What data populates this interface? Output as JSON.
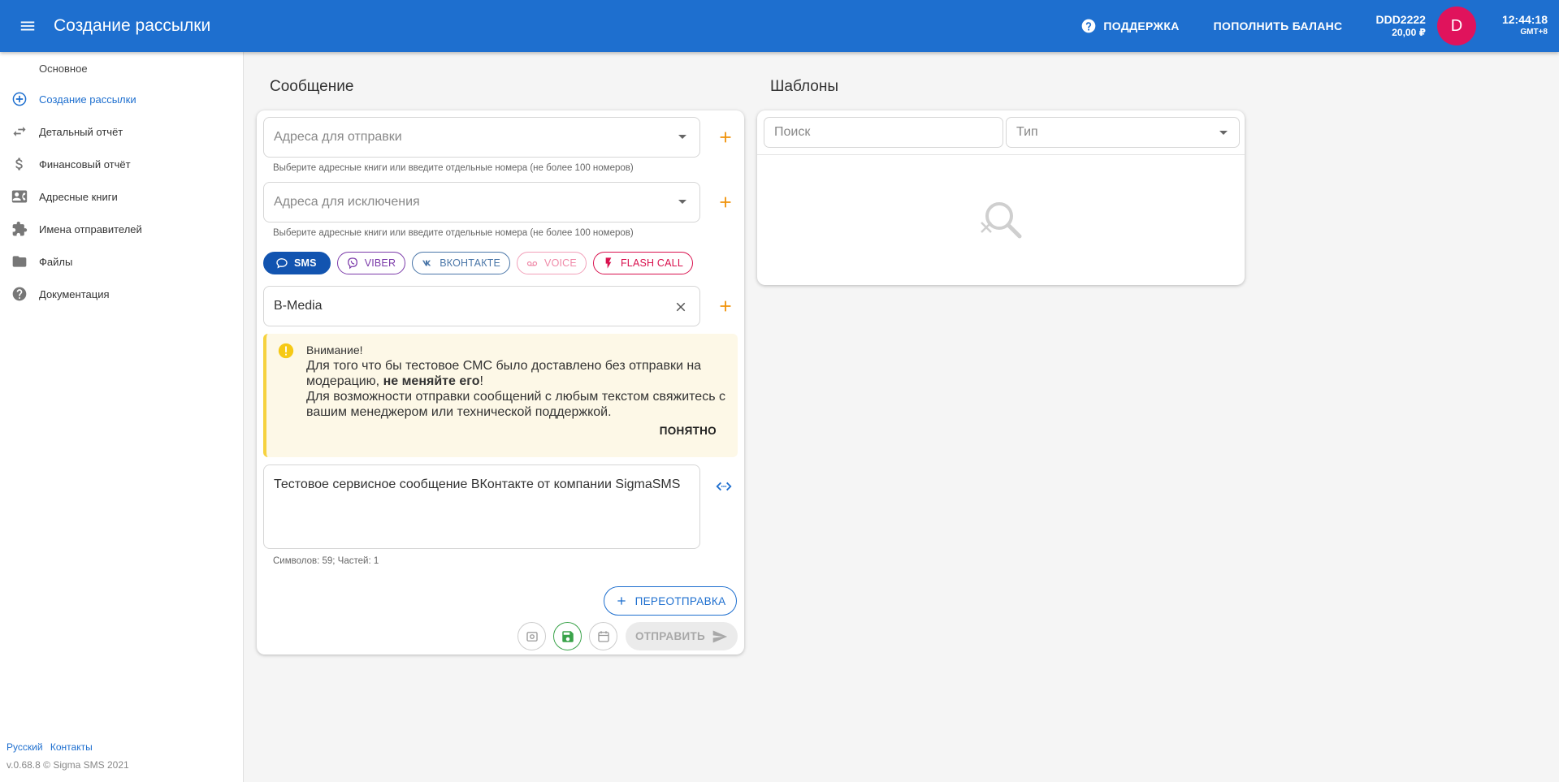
{
  "header": {
    "title": "Создание рассылки",
    "support_label": "ПОДДЕРЖКА",
    "topup_label": "ПОПОЛНИТЬ БАЛАНС",
    "account_name": "DDD2222",
    "balance": "20,00 ₽",
    "avatar_letter": "D",
    "time": "12:44:18",
    "timezone": "GMT+8",
    "colors": {
      "bar": "#1e6fcf",
      "avatar": "#e0135c"
    }
  },
  "sidebar": {
    "section": "Основное",
    "items": [
      {
        "label": "Создание рассылки",
        "icon": "plus-circle-icon",
        "active": true
      },
      {
        "label": "Детальный отчёт",
        "icon": "swap-arrows-icon"
      },
      {
        "label": "Финансовый отчёт",
        "icon": "dollar-icon"
      },
      {
        "label": "Адресные книги",
        "icon": "contact-card-icon"
      },
      {
        "label": "Имена отправителей",
        "icon": "puzzle-icon"
      },
      {
        "label": "Файлы",
        "icon": "folder-icon"
      },
      {
        "label": "Документация",
        "icon": "help-icon"
      }
    ],
    "footer": {
      "language": "Русский",
      "contacts": "Контакты",
      "version": "v.0.68.8 © Sigma SMS 2021"
    }
  },
  "message": {
    "heading": "Сообщение",
    "recipients": {
      "placeholder": "Адреса для отправки",
      "hint": "Выберите адресные книги или введите отдельные номера (не более 100 номеров)"
    },
    "exclusions": {
      "placeholder": "Адреса для исключения",
      "hint": "Выберите адресные книги или введите отдельные номера (не более 100 номеров)"
    },
    "channels": [
      {
        "label": "SMS",
        "icon": "chat-bubble-icon",
        "selected": true
      },
      {
        "label": "VIBER",
        "icon": "viber-icon"
      },
      {
        "label": "ВКОНТАКТЕ",
        "icon": "vk-icon"
      },
      {
        "label": "VOICE",
        "icon": "voicemail-icon"
      },
      {
        "label": "FLASH CALL",
        "icon": "flash-icon"
      }
    ],
    "sender": "B-Media",
    "alert": {
      "title": "Внимание!",
      "line1_before": "Для того что бы тестовое СМС было доставлено без отправки на модерацию, ",
      "line1_bold": "не меняйте его",
      "line1_after": "!",
      "line2": "Для возможности отправки сообщений с любым текстом свяжитесь с вашим менеджером или технической поддержкой.",
      "button": "ПОНЯТНО"
    },
    "text": "Тестовое сервисное сообщение ВКонтакте от компании SigmaSMS",
    "counter": "Символов: 59; Частей: 1",
    "resend_label": "ПЕРЕОТПРАВКА",
    "send_label": "ОТПРАВИТЬ"
  },
  "templates": {
    "heading": "Шаблоны",
    "search_placeholder": "Поиск",
    "type_placeholder": "Тип"
  }
}
